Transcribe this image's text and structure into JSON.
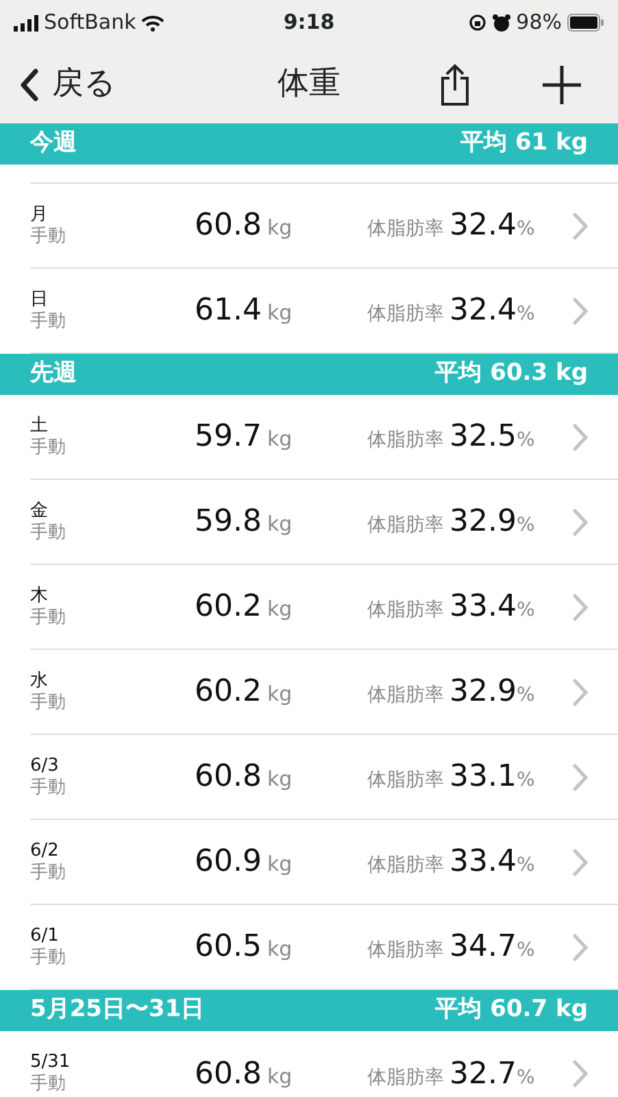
{
  "status_bar": {
    "carrier": "SoftBank",
    "time": "9:18",
    "battery": "98%"
  },
  "nav": {
    "back": "戻る",
    "title": "体重"
  },
  "sections": [
    {
      "title": "今週",
      "average": "平均 61 kg",
      "rows": [
        {
          "day": "月",
          "source": "手動",
          "weight": "60.8",
          "unit": "kg",
          "fat_label": "体脂肪率",
          "fat": "32.4",
          "fat_unit": "%"
        },
        {
          "day": "日",
          "source": "手動",
          "weight": "61.4",
          "unit": "kg",
          "fat_label": "体脂肪率",
          "fat": "32.4",
          "fat_unit": "%"
        }
      ]
    },
    {
      "title": "先週",
      "average": "平均 60.3 kg",
      "rows": [
        {
          "day": "土",
          "source": "手動",
          "weight": "59.7",
          "unit": "kg",
          "fat_label": "体脂肪率",
          "fat": "32.5",
          "fat_unit": "%"
        },
        {
          "day": "金",
          "source": "手動",
          "weight": "59.8",
          "unit": "kg",
          "fat_label": "体脂肪率",
          "fat": "32.9",
          "fat_unit": "%"
        },
        {
          "day": "木",
          "source": "手動",
          "weight": "60.2",
          "unit": "kg",
          "fat_label": "体脂肪率",
          "fat": "33.4",
          "fat_unit": "%"
        },
        {
          "day": "水",
          "source": "手動",
          "weight": "60.2",
          "unit": "kg",
          "fat_label": "体脂肪率",
          "fat": "32.9",
          "fat_unit": "%"
        },
        {
          "day": "6/3",
          "source": "手動",
          "weight": "60.8",
          "unit": "kg",
          "fat_label": "体脂肪率",
          "fat": "33.1",
          "fat_unit": "%"
        },
        {
          "day": "6/2",
          "source": "手動",
          "weight": "60.9",
          "unit": "kg",
          "fat_label": "体脂肪率",
          "fat": "33.4",
          "fat_unit": "%"
        },
        {
          "day": "6/1",
          "source": "手動",
          "weight": "60.5",
          "unit": "kg",
          "fat_label": "体脂肪率",
          "fat": "34.7",
          "fat_unit": "%"
        }
      ]
    },
    {
      "title": "5月25日〜31日",
      "average": "平均 60.7 kg",
      "rows": [
        {
          "day": "5/31",
          "source": "手動",
          "weight": "60.8",
          "unit": "kg",
          "fat_label": "体脂肪率",
          "fat": "32.7",
          "fat_unit": "%"
        }
      ]
    }
  ]
}
